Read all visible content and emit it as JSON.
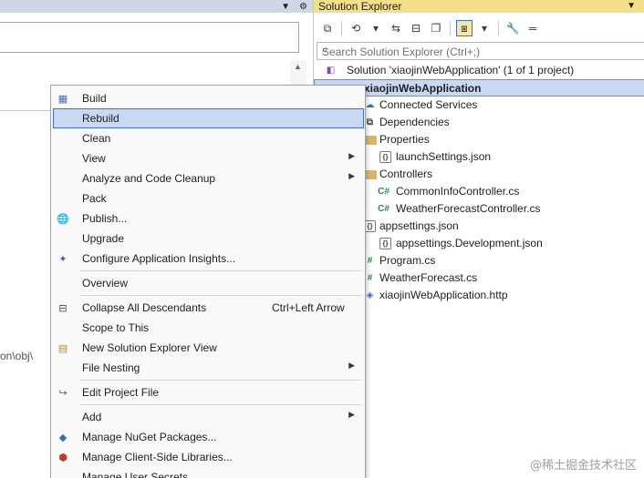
{
  "left": {
    "path_fragment": "on\\obj\\"
  },
  "solution_explorer": {
    "title": "Solution Explorer",
    "search_placeholder": "Search Solution Explorer (Ctrl+;)",
    "tree": [
      {
        "icon": "solution-icon",
        "label": "Solution 'xiaojinWebApplication' (1 of 1 project)"
      },
      {
        "icon": "project-icon",
        "label": "xiaojinWebApplication",
        "selected": true
      },
      {
        "icon": "connected-services-icon",
        "label": "Connected Services"
      },
      {
        "icon": "dependencies-icon",
        "label": "Dependencies"
      },
      {
        "icon": "folder-icon",
        "label": "Properties"
      },
      {
        "icon": "json-file-icon",
        "label": "launchSettings.json"
      },
      {
        "icon": "folder-icon",
        "label": "Controllers"
      },
      {
        "icon": "csharp-file-icon",
        "label": "CommonInfoController.cs"
      },
      {
        "icon": "csharp-file-icon",
        "label": "WeatherForecastController.cs"
      },
      {
        "icon": "json-file-icon",
        "label": "appsettings.json"
      },
      {
        "icon": "json-file-icon",
        "label": "appsettings.Development.json"
      },
      {
        "icon": "csharp-file-icon",
        "label": "Program.cs"
      },
      {
        "icon": "csharp-file-icon",
        "label": "WeatherForecast.cs"
      },
      {
        "icon": "http-file-icon",
        "label": "xiaojinWebApplication.http"
      }
    ]
  },
  "context_menu": {
    "items": [
      {
        "label": "Build",
        "icon": "build-icon"
      },
      {
        "label": "Rebuild",
        "highlighted": true
      },
      {
        "label": "Clean"
      },
      {
        "label": "View",
        "submenu": true
      },
      {
        "label": "Analyze and Code Cleanup",
        "submenu": true
      },
      {
        "label": "Pack"
      },
      {
        "label": "Publish...",
        "icon": "globe-icon"
      },
      {
        "label": "Upgrade"
      },
      {
        "label": "Configure Application Insights...",
        "icon": "insights-icon"
      },
      {
        "label": "Overview"
      },
      {
        "label": "Collapse All Descendants",
        "icon": "collapse-icon",
        "shortcut": "Ctrl+Left Arrow"
      },
      {
        "label": "Scope to This"
      },
      {
        "label": "New Solution Explorer View",
        "icon": "new-view-icon"
      },
      {
        "label": "File Nesting",
        "submenu": true
      },
      {
        "label": "Edit Project File",
        "icon": "edit-icon"
      },
      {
        "label": "Add",
        "submenu": true
      },
      {
        "label": "Manage NuGet Packages...",
        "icon": "nuget-icon"
      },
      {
        "label": "Manage Client-Side Libraries...",
        "icon": "libraries-icon"
      },
      {
        "label": "Manage User Secrets"
      }
    ]
  },
  "watermark": "@稀土掘金技术社区"
}
